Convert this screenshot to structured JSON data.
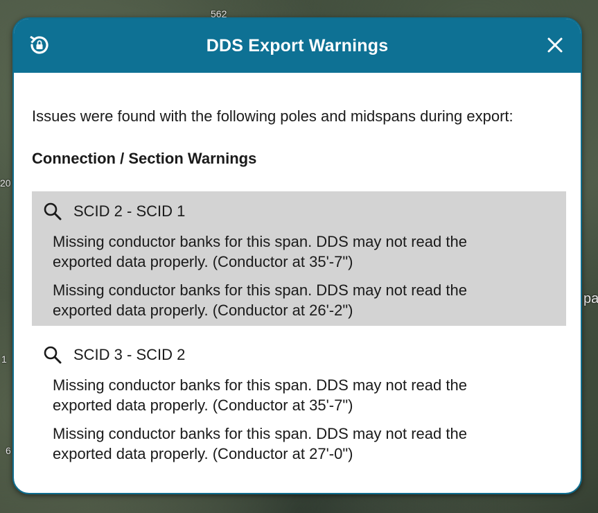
{
  "map": {
    "labels": [
      "562",
      "20",
      "pa",
      "1",
      "6"
    ]
  },
  "dialog": {
    "title": "DDS Export Warnings",
    "intro": "Issues were found with the following poles and midspans during export:",
    "section_heading": "Connection / Section Warnings",
    "groups": [
      {
        "title": "SCID 2 - SCID 1",
        "highlighted": true,
        "warnings": [
          "Missing conductor banks for this span. DDS may not read the exported data properly. (Conductor at 35'-7\")",
          "Missing conductor banks for this span. DDS may not read the exported data properly. (Conductor at 26'-2\")"
        ]
      },
      {
        "title": "SCID 3 - SCID 2",
        "highlighted": false,
        "warnings": [
          "Missing conductor banks for this span. DDS may not read the exported data properly. (Conductor at 35'-7\")",
          "Missing conductor banks for this span. DDS may not read the exported data properly. (Conductor at 27'-0\")"
        ]
      }
    ]
  },
  "colors": {
    "header": "#0e7194",
    "highlight": "#d3d3d3",
    "text": "#1a1a1a"
  },
  "icons": {
    "left_header": "history-lock-icon",
    "right_header": "close-icon",
    "group": "search-icon"
  }
}
